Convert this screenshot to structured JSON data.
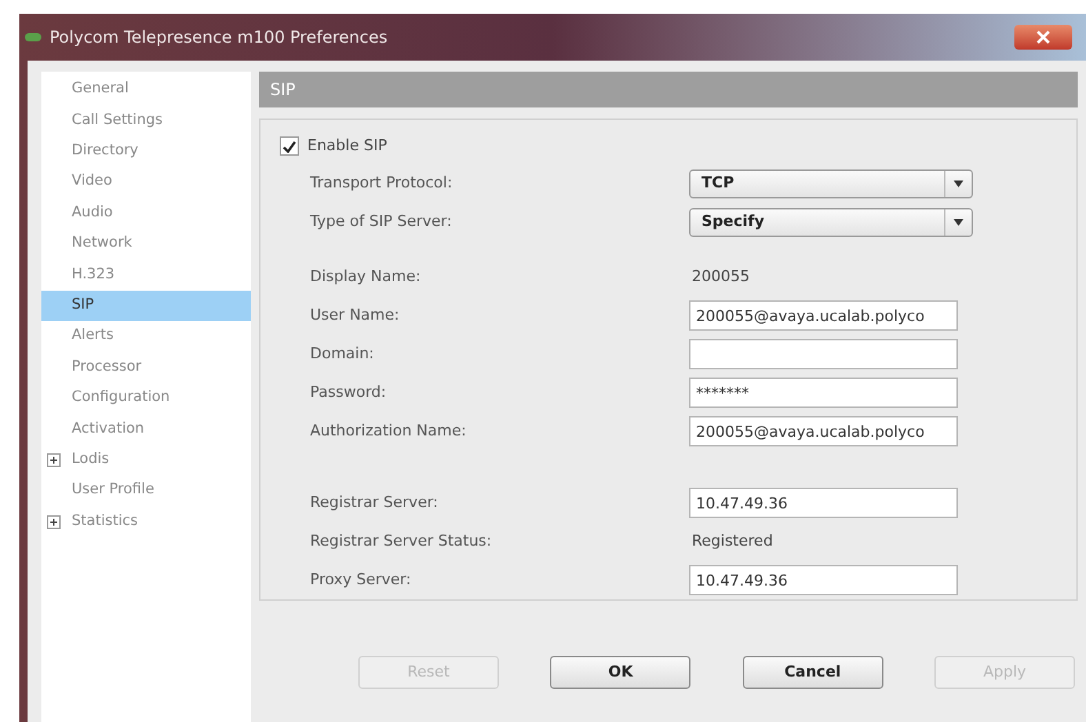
{
  "window": {
    "title": "Polycom Telepresence m100 Preferences"
  },
  "sidebar": {
    "items": [
      {
        "label": "General",
        "selected": false
      },
      {
        "label": "Call Settings",
        "selected": false
      },
      {
        "label": "Directory",
        "selected": false
      },
      {
        "label": "Video",
        "selected": false
      },
      {
        "label": "Audio",
        "selected": false
      },
      {
        "label": "Network",
        "selected": false
      },
      {
        "label": "H.323",
        "selected": false
      },
      {
        "label": "SIP",
        "selected": true
      },
      {
        "label": "Alerts",
        "selected": false
      },
      {
        "label": "Processor",
        "selected": false
      },
      {
        "label": "Configuration",
        "selected": false
      },
      {
        "label": "Activation",
        "selected": false
      },
      {
        "label": "Lodis",
        "selected": false,
        "expanded": false
      },
      {
        "label": "User Profile",
        "selected": false
      },
      {
        "label": "Statistics",
        "selected": false,
        "expanded": false
      }
    ]
  },
  "panel": {
    "title": "SIP",
    "enable": {
      "label": "Enable SIP",
      "checked": true
    },
    "groups": [
      [
        {
          "kind": "select",
          "label": "Transport Protocol:",
          "value": "TCP"
        },
        {
          "kind": "select",
          "label": "Type of SIP Server:",
          "value": "Specify"
        }
      ],
      [
        {
          "kind": "static",
          "label": "Display Name:",
          "value": "200055"
        },
        {
          "kind": "input",
          "label": "User Name:",
          "value": "200055@avaya.ucalab.polyco"
        },
        {
          "kind": "input",
          "label": "Domain:"
        },
        {
          "kind": "input",
          "label": "Password:",
          "value": "*******"
        },
        {
          "kind": "input",
          "label": "Authorization Name:",
          "value": "200055@avaya.ucalab.polyco"
        }
      ],
      [
        {
          "kind": "input",
          "label": "Registrar Server:",
          "value": "10.47.49.36"
        },
        {
          "kind": "static",
          "label": "Registrar Server Status:",
          "value": "Registered"
        },
        {
          "kind": "input",
          "label": "Proxy Server:",
          "value": "10.47.49.36"
        }
      ]
    ]
  },
  "buttons": [
    {
      "label": "Reset",
      "disabled": true
    },
    {
      "label": "OK",
      "disabled": false
    },
    {
      "label": "Cancel",
      "disabled": false
    },
    {
      "label": "Apply",
      "disabled": true
    }
  ]
}
